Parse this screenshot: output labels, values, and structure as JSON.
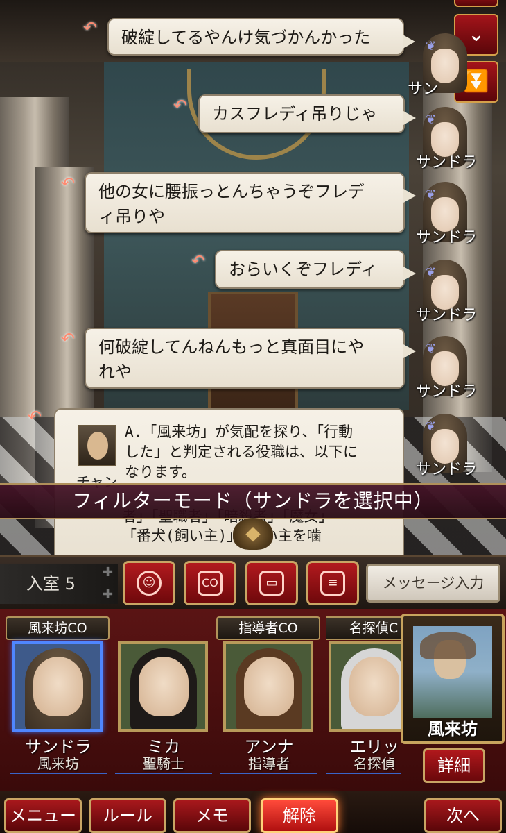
{
  "messages": [
    {
      "text": "破綻してるやんけ気づかんかった",
      "speaker": "サン"
    },
    {
      "text": "カスフレディ吊りじゃ",
      "speaker": "サンドラ"
    },
    {
      "text_line1": "他の女に腰振っとんちゃうぞフレデ",
      "text_line2": "ィ吊りや",
      "speaker": "サンドラ"
    },
    {
      "text": "おらいくぞフレディ",
      "speaker": "サンドラ"
    },
    {
      "text_line1": "何破綻してんねんもっと真面目にや",
      "text_line2": "れや",
      "speaker": "サンドラ"
    },
    {
      "speaker": "サンドラ"
    }
  ],
  "system_message": {
    "sender": "チャン",
    "line1": "A.「風来坊」が気配を探り、「行動",
    "line2": "した」と判定される役職は、以下に",
    "line3": "なります。",
    "more_line1": "者」「聖職者」「暗殺者」「魔女」",
    "more_line2": "「番犬(飼い主)」「飼い主を噛"
  },
  "filter_banner": "フィルターモード（サンドラを選択中）",
  "action_bar": {
    "room_label": "入室 5",
    "co_label": "CO",
    "message_input": "メッセージ入力"
  },
  "players": [
    {
      "co": "風来坊CO",
      "name": "サンドラ",
      "role": "風来坊",
      "selected": true
    },
    {
      "co": "",
      "name": "ミカ",
      "role": "聖騎士"
    },
    {
      "co": "指導者CO",
      "name": "アンナ",
      "role": "指導者"
    },
    {
      "co": "名探偵C",
      "name": "エリッ",
      "role": "名探偵"
    }
  ],
  "role_card": {
    "name": "風来坊",
    "detail_label": "詳細"
  },
  "bottom_menu": {
    "menu": "メニュー",
    "rules": "ルール",
    "memo": "メモ",
    "release": "解除",
    "next": "次へ"
  },
  "colors": {
    "accent_red": "#a8181c",
    "gold_border": "#c9a564",
    "selected_blue": "#4f86ff"
  }
}
